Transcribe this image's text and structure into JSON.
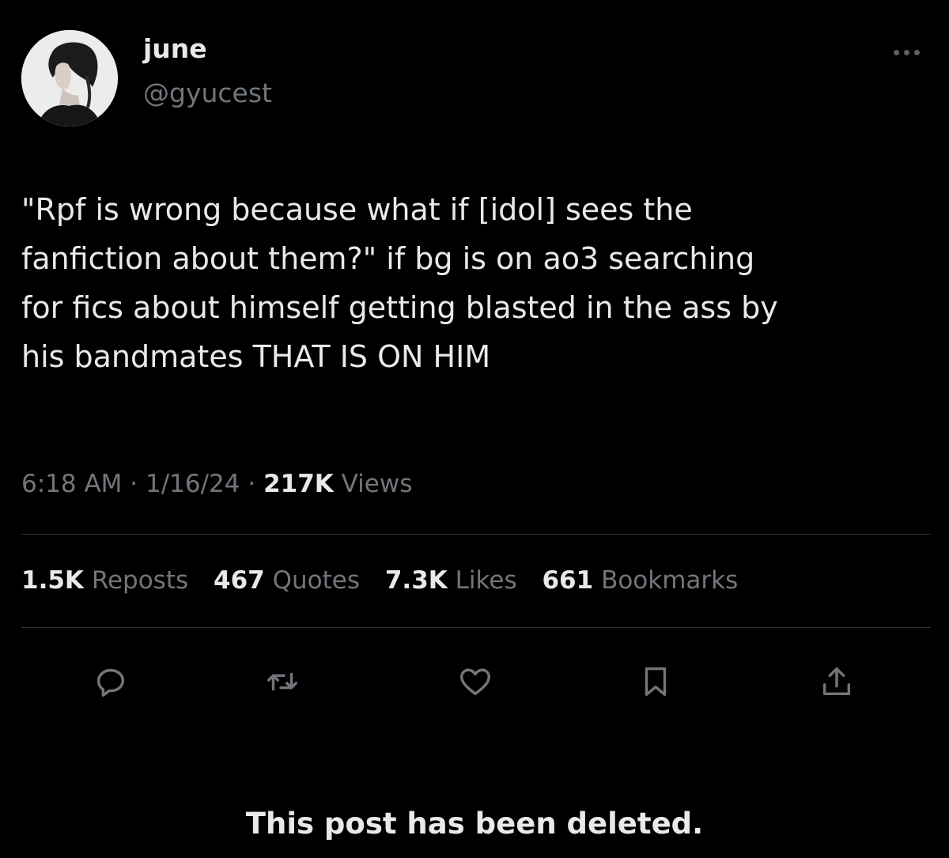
{
  "author": {
    "display_name": "june",
    "handle": "@gyucest",
    "avatar_icon": "profile-photo"
  },
  "more_icon": "ellipsis-icon",
  "tweet": {
    "text": "\"Rpf is wrong because what if [idol] sees the\nfanfiction about them?\" if bg is on ao3 searching\nfor fics about himself getting blasted in the ass by\nhis bandmates THAT IS ON HIM"
  },
  "meta": {
    "time": "6:18 AM",
    "separator": " · ",
    "date": "1/16/24",
    "views_count": "217K",
    "views_label": "Views"
  },
  "stats": [
    {
      "count": "1.5K",
      "label": "Reposts"
    },
    {
      "count": "467",
      "label": "Quotes"
    },
    {
      "count": "7.3K",
      "label": "Likes"
    },
    {
      "count": "661",
      "label": "Bookmarks"
    }
  ],
  "actions": [
    {
      "icon": "reply-icon"
    },
    {
      "icon": "repost-icon"
    },
    {
      "icon": "like-icon"
    },
    {
      "icon": "bookmark-icon"
    },
    {
      "icon": "share-icon"
    }
  ],
  "deleted_notice": "This post has been deleted.",
  "colors": {
    "background": "#000000",
    "text_primary": "#e7e9ea",
    "text_secondary": "#71767b",
    "divider": "#2f3336"
  }
}
